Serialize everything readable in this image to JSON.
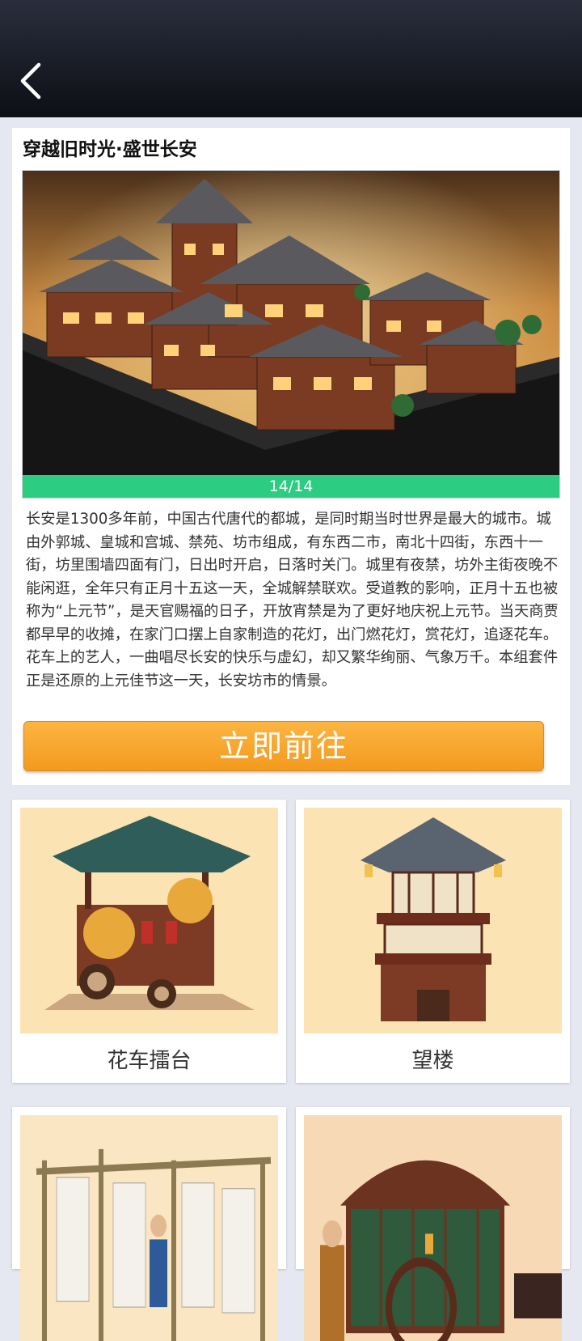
{
  "header": {
    "back_icon": "chevron-left-icon"
  },
  "feature": {
    "title": "穿越旧时光·盛世长安",
    "pager": "14/14",
    "description": "长安是1300多年前，中国古代唐代的都城，是同时期当时世界是最大的城市。城由外郭城、皇城和宫城、禁苑、坊市组成，有东西二市，南北十四街，东西十一街，坊里围墙四面有门，日出时开启，日落时关门。城里有夜禁，坊外主街夜晚不能闲逛，全年只有正月十五这一天，全城解禁联欢。受道教的影响，正月十五也被称为“上元节”，是天官赐福的日子，开放宵禁是为了更好地庆祝上元节。当天商贾都早早的收摊，在家门口摆上自家制造的花灯，出门燃花灯，赏花灯，追逐花车。花车上的艺人，一曲唱尽长安的快乐与虚幻，却又繁华绚丽、气象万千。本组套件正是还原的上元佳节这一天，长安坊市的情景。",
    "button": "立即前往"
  },
  "items": [
    {
      "label": "花车擂台"
    },
    {
      "label": "望楼"
    },
    {
      "label": ""
    },
    {
      "label": ""
    }
  ],
  "colors": {
    "accent_green": "#2ccc83",
    "button_orange": "#f7a52c"
  }
}
